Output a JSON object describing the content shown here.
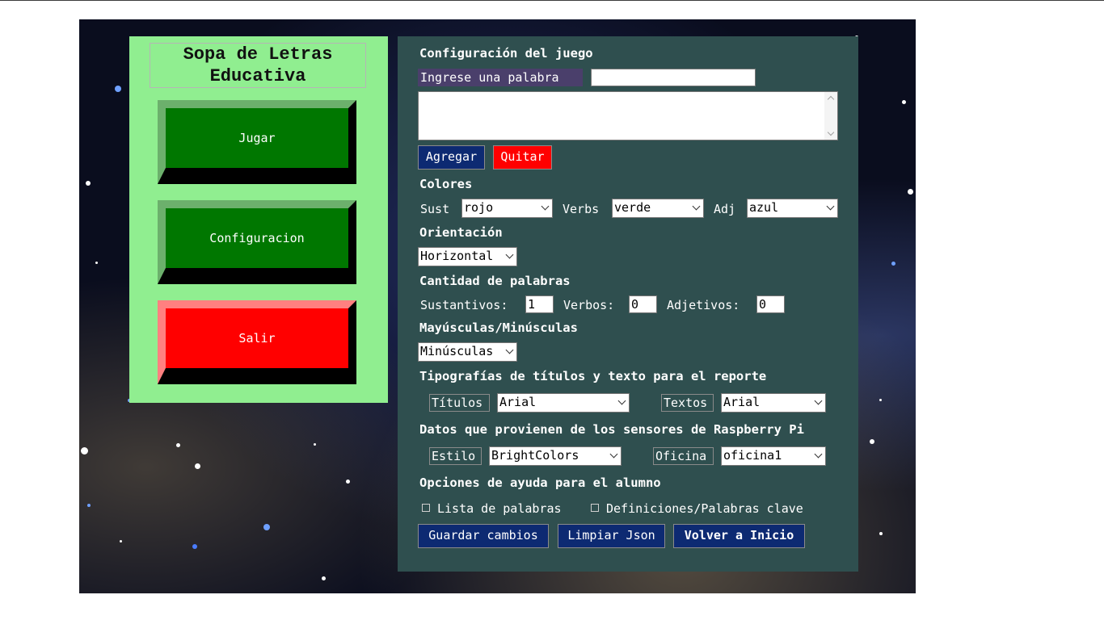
{
  "menu": {
    "title": "Sopa de Letras\nEducativa",
    "play_label": "Jugar",
    "config_label": "Configuracion",
    "exit_label": "Salir"
  },
  "config": {
    "heading": "Configuración del juego",
    "word_label": "Ingrese una palabra",
    "word_value": "",
    "add_label": "Agregar",
    "remove_label": "Quitar",
    "colors": {
      "heading": "Colores",
      "noun_label": "Sust",
      "noun_value": "rojo",
      "verb_label": "Verbs",
      "verb_value": "verde",
      "adj_label": "Adj",
      "adj_value": "azul"
    },
    "orientation": {
      "heading": "Orientación",
      "value": "Horizontal"
    },
    "word_count": {
      "heading": "Cantidad de palabras",
      "nouns_label": "Sustantivos:",
      "nouns_value": "1",
      "verbs_label": "Verbos:",
      "verbs_value": "0",
      "adjs_label": "Adjetivos:",
      "adjs_value": "0"
    },
    "case": {
      "heading": "Mayúsculas/Minúsculas",
      "value": "Minúsculas"
    },
    "fonts": {
      "heading": "Tipografías de títulos y texto para el reporte",
      "titles_label": "Títulos",
      "titles_value": "Arial",
      "texts_label": "Textos",
      "texts_value": "Arial"
    },
    "sensors": {
      "heading": "Datos que provienen de los sensores de Raspberry Pi",
      "style_label": "Estilo",
      "style_value": "BrightColors",
      "office_label": "Oficina",
      "office_value": "oficina1"
    },
    "help": {
      "heading": "Opciones de ayuda para el alumno",
      "word_list_label": "Lista de palabras",
      "definitions_label": "Definiciones/Palabras clave"
    },
    "save_label": "Guardar cambios",
    "clear_label": "Limpiar Json",
    "back_label": "Volver a Inicio"
  },
  "colors": {
    "menu_bg": "#90ee90",
    "config_bg": "#2f4f4f",
    "green_button": "#007700",
    "red_button": "#ff0000",
    "navy_button": "#0d2a72"
  }
}
